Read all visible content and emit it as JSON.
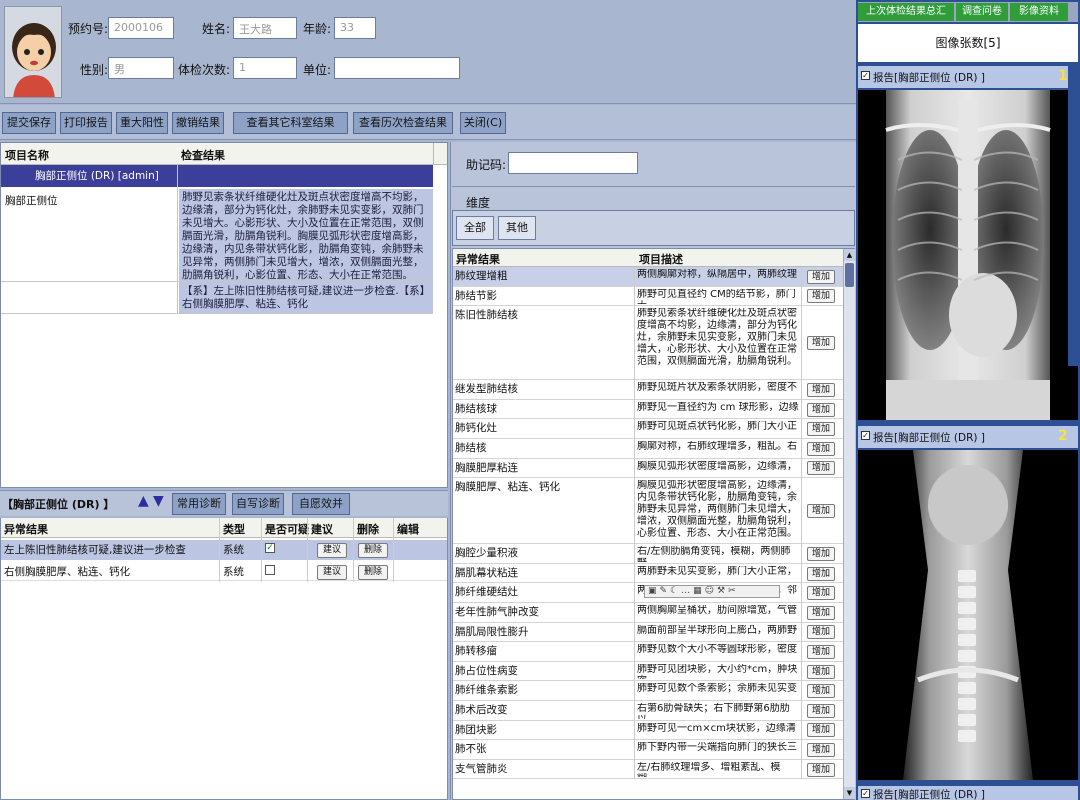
{
  "patient": {
    "booking_label": "预约号:",
    "booking_value": "2000106",
    "name_label": "姓名:",
    "name_value": "王大路",
    "age_label": "年龄:",
    "age_value": "33",
    "gender_label": "性别:",
    "gender_value": "男",
    "exam_count_label": "体检次数:",
    "exam_count_value": "1",
    "unit_label": "单位:",
    "unit_value": ""
  },
  "toolbar": [
    "提交保存",
    "打印报告",
    "重大阳性",
    "撤销结果",
    "查看其它科室结果",
    "查看历次检查结果",
    "关闭(C)"
  ],
  "results": {
    "col_name": "项目名称",
    "col_result": "检查结果",
    "group_row": "胸部正侧位 (DR) [admin]",
    "item_name": "胸部正侧位",
    "item_result": "肺野见索条状纤维硬化灶及斑点状密度增高不均影，边缘清，部分为钙化灶，余肺野未见实变影，双肺门未见增大。心影形状、大小及位置在正常范围，双侧膈面光滑，肋膈角锐利。胸膜见弧形状密度增高影，边缘清，内见条带状钙化影，肋膈角变钝，余肺野未见异常，两侧肺门未见增大，增浓，双侧膈面光整，肋膈角锐利，心影位置、形态、大小在正常范围。",
    "conclusion": "【系】左上陈旧性肺结核可疑,建议进一步检查.【系】右侧胸膜肥厚、粘连、钙化"
  },
  "diag": {
    "title": "【胸部正侧位 (DR) 】",
    "btn_common": "常用诊断",
    "btn_self": "自写诊断",
    "btn_advice": "自愿效并",
    "headers": [
      "异常结果",
      "类型",
      "是否可疑",
      "建议",
      "删除",
      "编辑"
    ],
    "rows": [
      {
        "name": "左上陈旧性肺结核可疑,建议进一步检查",
        "type": "系统",
        "checked": true,
        "advice": "建议",
        "del": "删除"
      },
      {
        "name": "右侧胸膜肥厚、粘连、钙化",
        "type": "系统",
        "checked": false,
        "advice": "建议",
        "del": "删除"
      }
    ]
  },
  "middle": {
    "mnemonic_label": "助记码:",
    "mnemonic_value": "",
    "dimension_label": "维度",
    "tab_all": "全部",
    "tab_other": "其他",
    "col_abnormal": "异常结果",
    "col_desc": "项目描述",
    "add_label": "增加",
    "rows": [
      {
        "name": "肺纹理增粗",
        "desc": "两侧胸廓对称，纵隔居中，两肺纹理"
      },
      {
        "name": "肺结节影",
        "desc": "肺野可见直径约 CM的结节影，肺门大"
      },
      {
        "name": "陈旧性肺结核",
        "desc": "肺野见索条状纤维硬化灶及斑点状密度增高不均影，边缘清，部分为钙化灶，余肺野未见实变影，双肺门未见增大，心影形状、大小及位置在正常范围，双侧膈面光滑，肋膈角锐利。"
      },
      {
        "name": "继发型肺结核",
        "desc": "肺野见斑片状及索条状阴影，密度不"
      },
      {
        "name": "肺结核球",
        "desc": "肺野见一直径约为  cm 球形影，边缘"
      },
      {
        "name": "肺钙化灶",
        "desc": "肺野可见斑点状钙化影，肺门大小正"
      },
      {
        "name": "肺结核",
        "desc": "胸廓对称，右肺纹理增多，粗乱。右"
      },
      {
        "name": "胸膜肥厚粘连",
        "desc": "胸膜见弧形状密度增高影，边缘清，"
      },
      {
        "name": "胸膜肥厚、粘连、钙化",
        "desc": "胸膜见弧形状密度增高影，边缘清，内见条带状钙化影，肋膈角变钝，余肺野未见异常，两侧肺门未见增大，增浓，双侧膈面光整，肋膈角锐利，心影位置、形态、大小在正常范围。"
      },
      {
        "name": "胸腔少量积液",
        "desc": "右/左侧肋膈角变钝，模糊，两侧肺野"
      },
      {
        "name": "膈肌幕状粘连",
        "desc": "两肺野未见实变影，肺门大小正常，"
      },
      {
        "name": "肺纤维硬结灶",
        "desc": "两上肺野可见纤维条索及钙化影，邻"
      },
      {
        "name": "老年性肺气肿改变",
        "desc": "两侧胸廓呈桶状，肋间隙增宽，气管"
      },
      {
        "name": "膈肌局限性膨升",
        "desc": "膈面前部呈半球形向上膨凸，两肺野"
      },
      {
        "name": "肺转移瘤",
        "desc": "肺野见数个大小不等圆球形影，密度"
      },
      {
        "name": "肺占位性病变",
        "desc": "肺野可见团块影，大小约*cm，肿块密"
      },
      {
        "name": "肺纤维条索影",
        "desc": "肺野可见数个条索影；余肺未见实变"
      },
      {
        "name": "肺术后改变",
        "desc": "右第6肋骨缺失；右下肺野第6肋肋以"
      },
      {
        "name": "肺团块影",
        "desc": "肺野可见一cm×cm块状影，边缘清"
      },
      {
        "name": "肺不张",
        "desc": "肺下野内带一尖端指向肺门的狭长三"
      },
      {
        "name": "支气管肺炎",
        "desc": "左/右肺纹理增多、增粗紊乱、模糊，"
      }
    ]
  },
  "right": {
    "tabs": [
      "上次体检结果总汇",
      "调查问卷",
      "影像资料"
    ],
    "image_count": "图像张数[5]",
    "reports": [
      {
        "label": "报告[胸部正侧位 (DR) ]",
        "index": "1"
      },
      {
        "label": "报告[胸部正侧位 (DR) ]",
        "index": "2"
      },
      {
        "label": "报告[胸部正侧位 (DR) ]",
        "index": ""
      }
    ]
  },
  "colors": {
    "accent": "#3b3f99",
    "header_bg": "#a9b6cf",
    "highlight": "#bcc5e2"
  }
}
